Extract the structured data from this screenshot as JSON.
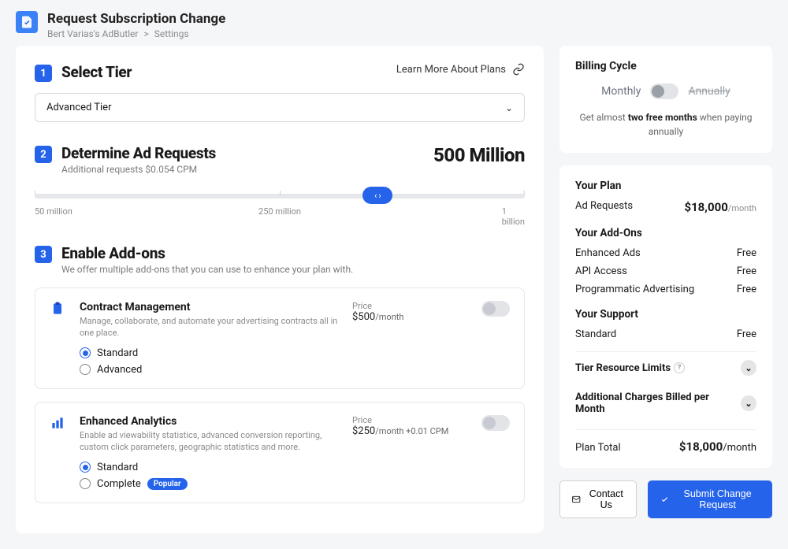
{
  "header": {
    "title": "Request Subscription Change",
    "breadcrumb_account": "Bert Varias's AdButler",
    "breadcrumb_sep": ">",
    "breadcrumb_page": "Settings"
  },
  "sections": {
    "tier": {
      "step": "1",
      "title": "Select Tier",
      "learn_more": "Learn More About Plans",
      "selected": "Advanced Tier"
    },
    "requests": {
      "step": "2",
      "title": "Determine Ad Requests",
      "subtitle": "Additional requests $0.054 CPM",
      "amount": "500 Million",
      "ticks": [
        "50 million",
        "250 million",
        "1 billion"
      ]
    },
    "addons": {
      "step": "3",
      "title": "Enable Add-ons",
      "subtitle": "We offer multiple add-ons that you can use to enhance your plan with.",
      "items": [
        {
          "name": "Contract Management",
          "desc": "Manage, collaborate, and automate your advertising contracts all in one place.",
          "price_label": "Price",
          "price": "$500",
          "price_unit": "/month",
          "price_extra": "",
          "opts": [
            {
              "label": "Standard",
              "selected": true,
              "badge": ""
            },
            {
              "label": "Advanced",
              "selected": false,
              "badge": ""
            }
          ]
        },
        {
          "name": "Enhanced Analytics",
          "desc": "Enable ad viewability statistics, advanced conversion reporting, custom click parameters, geographic statistics and more.",
          "price_label": "Price",
          "price": "$250",
          "price_unit": "/month",
          "price_extra": "+0.01 CPM",
          "opts": [
            {
              "label": "Standard",
              "selected": true,
              "badge": ""
            },
            {
              "label": "Complete",
              "selected": false,
              "badge": "Popular"
            }
          ]
        }
      ]
    }
  },
  "billing": {
    "title": "Billing Cycle",
    "monthly": "Monthly",
    "annually": "Annually",
    "note_pre": "Get almost ",
    "note_bold": "two free months",
    "note_post": " when paying annually"
  },
  "plan": {
    "your_plan": "Your Plan",
    "ad_requests_label": "Ad Requests",
    "ad_requests_price": "$18,000",
    "ad_requests_unit": "/month",
    "your_addons": "Your Add-Ons",
    "addons": [
      {
        "label": "Enhanced Ads",
        "value": "Free"
      },
      {
        "label": "API Access",
        "value": "Free"
      },
      {
        "label": "Programmatic Advertising",
        "value": "Free"
      }
    ],
    "your_support": "Your Support",
    "support_label": "Standard",
    "support_value": "Free",
    "tier_limits": "Tier Resource Limits",
    "additional_charges": "Additional Charges Billed per Month",
    "total_label": "Plan Total",
    "total_price": "$18,000",
    "total_unit": "/month"
  },
  "footer": {
    "contact": "Contact Us",
    "submit": "Submit Change Request"
  }
}
